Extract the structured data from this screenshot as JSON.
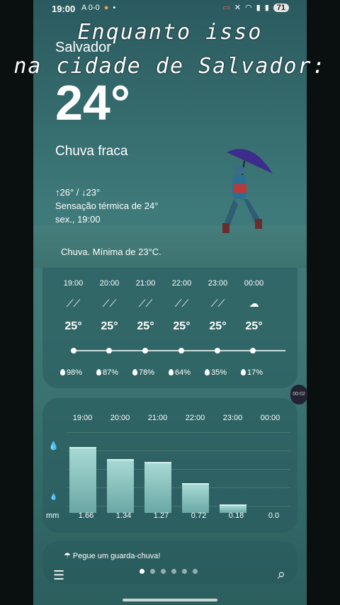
{
  "status": {
    "time": "19:00",
    "left_extra": "A 0-0",
    "battery": "71"
  },
  "overlay": {
    "line1": "Enquanto isso",
    "line2": "na cidade de Salvador:"
  },
  "weather": {
    "city": "Salvador",
    "temperature": "24°",
    "condition": "Chuva fraca",
    "hilo": "↑26° / ↓23°",
    "feels_like": "Sensação térmica de 24°",
    "date": "sex., 19:00",
    "summary": "Chuva. Mínima de 23°C."
  },
  "hourly": {
    "hours": [
      "19:00",
      "20:00",
      "21:00",
      "22:00",
      "23:00",
      "00:00"
    ],
    "temps": [
      "25°",
      "25°",
      "25°",
      "25°",
      "25°",
      "25°"
    ],
    "precip": [
      "98%",
      "87%",
      "78%",
      "64%",
      "35%",
      "17%"
    ],
    "icons": [
      "rain-icon",
      "rain-icon",
      "rain-icon",
      "rain-icon",
      "rain-icon",
      "cloud-icon"
    ]
  },
  "rainfall": {
    "hours": [
      "19:00",
      "20:00",
      "21:00",
      "22:00",
      "23:00",
      "00:00"
    ],
    "unit": "mm",
    "values_label": [
      "1.66",
      "1.34",
      "1.27",
      "0.72",
      "0.18",
      "0.0"
    ],
    "values": [
      1.66,
      1.34,
      1.27,
      0.72,
      0.18,
      0.0
    ]
  },
  "tip": "Pegue um guarda-chuva!",
  "nav": {
    "pages": 6,
    "active": 0
  },
  "side_button_label": "00:02"
}
